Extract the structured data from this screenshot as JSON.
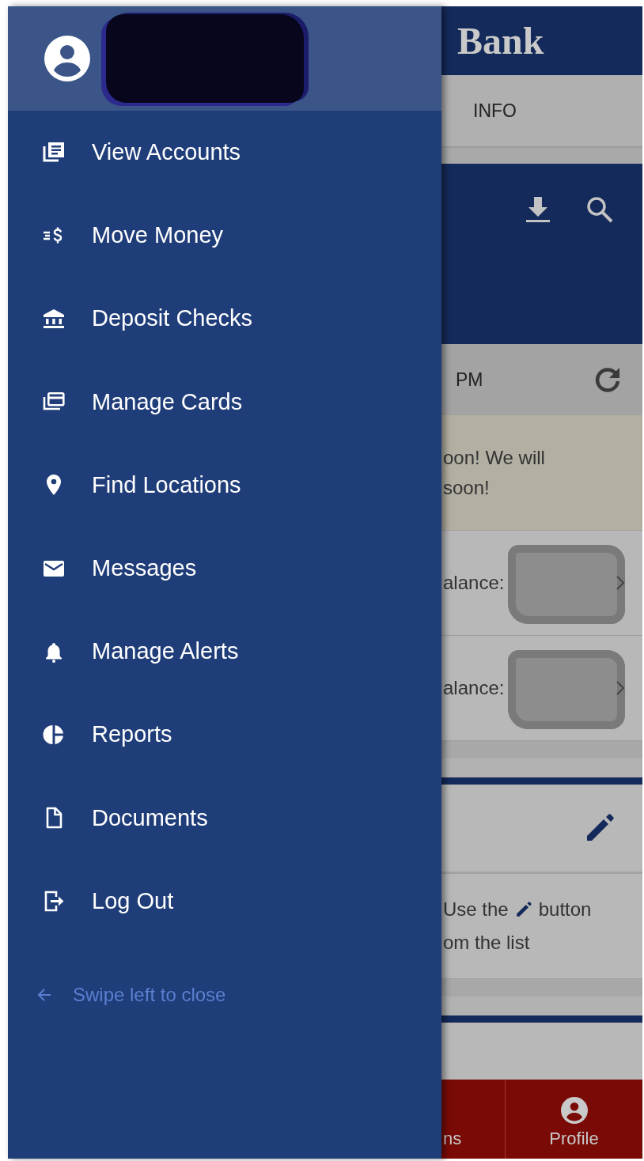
{
  "drawer": {
    "menu_items": [
      {
        "label": "View Accounts"
      },
      {
        "label": "Move Money"
      },
      {
        "label": "Deposit Checks"
      },
      {
        "label": "Manage Cards"
      },
      {
        "label": "Find Locations"
      },
      {
        "label": "Messages"
      },
      {
        "label": "Manage Alerts"
      },
      {
        "label": "Reports"
      },
      {
        "label": "Documents"
      },
      {
        "label": "Log Out"
      }
    ],
    "swipe_hint": "Swipe left to close"
  },
  "background": {
    "app_title": "Bank",
    "tab": "INFO",
    "updated_time": "PM",
    "notice_lines": [
      "oon! We will",
      "soon!"
    ],
    "accounts": [
      {
        "balance_label": "alance:"
      },
      {
        "balance_label": "alance:"
      }
    ],
    "hint": {
      "before_icon": "Use the",
      "after_icon": "button",
      "second_line": "om the list"
    },
    "bottom_nav": [
      {
        "label": "ns"
      },
      {
        "label": "Profile"
      }
    ]
  }
}
